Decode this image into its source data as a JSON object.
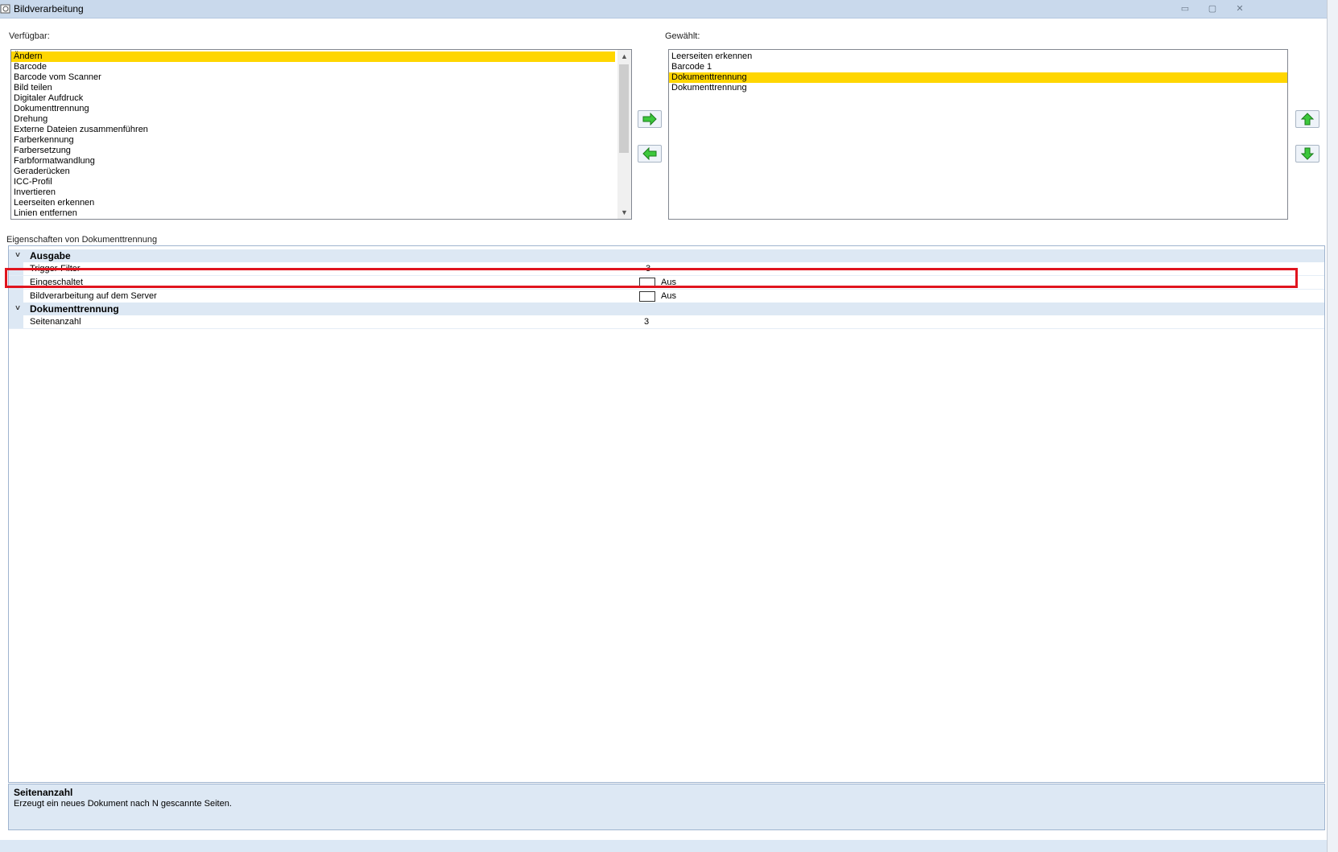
{
  "window": {
    "title": "Bildverarbeitung",
    "controls": {
      "minimize": "▭",
      "maximize": "▢",
      "close": "✕"
    }
  },
  "available": {
    "label": "Verfügbar:",
    "items": [
      "Ändern",
      "Barcode",
      "Barcode vom Scanner",
      "Bild teilen",
      "Digitaler Aufdruck",
      "Dokumenttrennung",
      "Drehung",
      "Externe Dateien zusammenführen",
      "Farberkennung",
      "Farbersetzung",
      "Farbformatwandlung",
      "Geraderücken",
      "ICC-Profil",
      "Invertieren",
      "Leerseiten erkennen",
      "Linien entfernen"
    ],
    "selected_index": 0
  },
  "selected": {
    "label": "Gewählt:",
    "items": [
      "Leerseiten erkennen",
      "Barcode 1",
      "Dokumenttrennung",
      "Dokumenttrennung"
    ],
    "selected_index": 2
  },
  "properties": {
    "label": "Eigenschaften von Dokumenttrennung",
    "categories": [
      {
        "name": "Ausgabe",
        "rows": [
          {
            "name": "Trigger-Filter",
            "value": "3"
          },
          {
            "name": "Eingeschaltet",
            "checkbox": true,
            "value": "Aus"
          },
          {
            "name": "Bildverarbeitung auf dem Server",
            "checkbox": true,
            "value": "Aus"
          }
        ]
      },
      {
        "name": "Dokumenttrennung",
        "rows": [
          {
            "name": "Seitenanzahl",
            "value": "3"
          }
        ]
      }
    ]
  },
  "description": {
    "title": "Seitenanzahl",
    "text": "Erzeugt ein neues Dokument nach N gescannte Seiten."
  },
  "colors": {
    "selection": "#ffd600",
    "highlight_box": "#e0141e",
    "arrow_green": "#3cc83c",
    "category_bg": "#dde8f4"
  },
  "icons": {
    "move_right": "arrow-right-icon",
    "move_left": "arrow-left-icon",
    "move_up": "arrow-up-icon",
    "move_down": "arrow-down-icon"
  }
}
